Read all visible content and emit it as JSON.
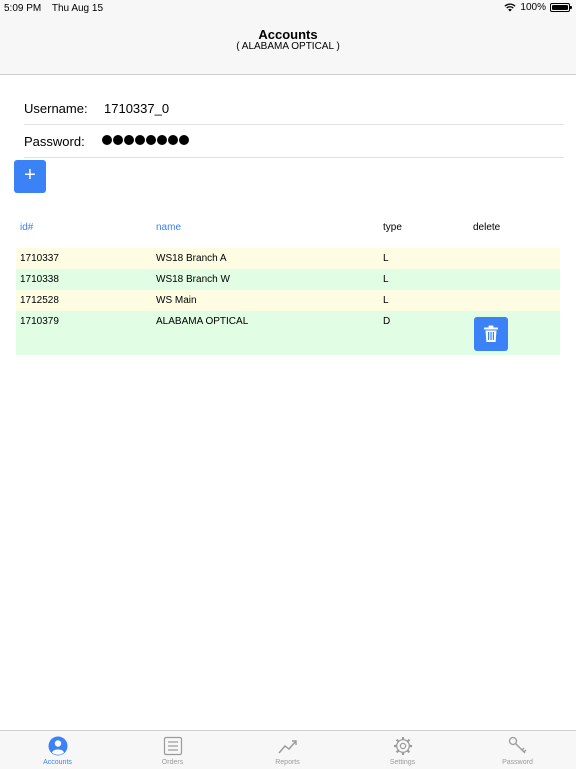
{
  "status_bar": {
    "time": "5:09 PM",
    "date": "Thu Aug 15",
    "battery": "100%"
  },
  "nav": {
    "title": "Accounts",
    "subtitle": "( ALABAMA OPTICAL )"
  },
  "form": {
    "username_label": "Username:",
    "username_value": "1710337_0",
    "password_label": "Password:",
    "password_dot_count": 8
  },
  "add_button": {
    "label": "+"
  },
  "table": {
    "headers": {
      "id": "id#",
      "name": "name",
      "type": "type",
      "delete": "delete"
    },
    "rows": [
      {
        "id": "1710337",
        "name": "WS18 Branch A",
        "type": "L",
        "color": "#fefde3"
      },
      {
        "id": "1710338",
        "name": "WS18 Branch W",
        "type": "L",
        "color": "#e1fde3"
      },
      {
        "id": "1712528",
        "name": "WS Main",
        "type": "L",
        "color": "#fefde3"
      },
      {
        "id": "1710379",
        "name": "ALABAMA OPTICAL",
        "type": "D",
        "color": "#e1fde3",
        "deletable": true
      }
    ]
  },
  "tab_bar": {
    "tabs": [
      {
        "label": "Accounts",
        "icon": "person-circle-icon",
        "active": true
      },
      {
        "label": "Orders",
        "icon": "list-icon",
        "active": false
      },
      {
        "label": "Reports",
        "icon": "chart-trend-icon",
        "active": false
      },
      {
        "label": "Settings",
        "icon": "gear-icon",
        "active": false
      },
      {
        "label": "Password",
        "icon": "key-icon",
        "active": false
      }
    ]
  },
  "colors": {
    "accent": "#3b82f6",
    "row_yellow": "#fefde3",
    "row_green": "#e1fde3",
    "inactive": "#9a9a9a"
  }
}
